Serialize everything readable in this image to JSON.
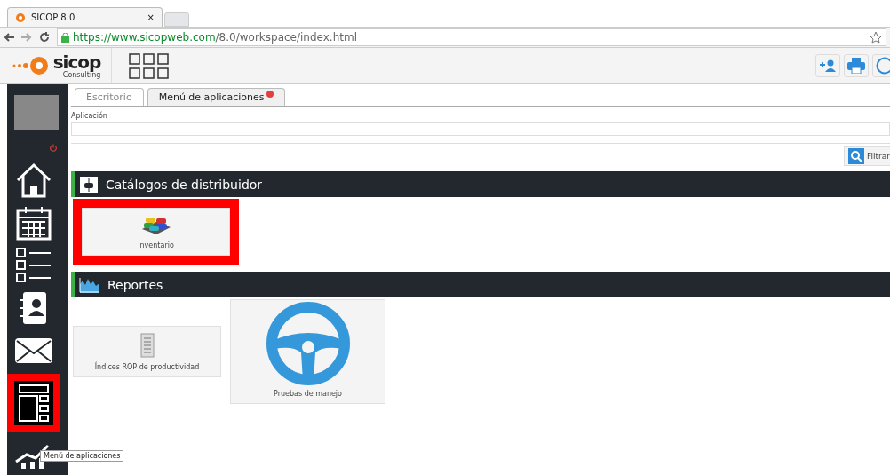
{
  "browser": {
    "tab_title": "SICOP 8.0",
    "tab_close": "×",
    "url_host": "https://www.sicopweb.com",
    "url_path": "/8.0/workspace/index.html"
  },
  "app": {
    "logo_text": "sicop",
    "logo_sub": "Consulting"
  },
  "sidebar": {
    "items": [
      {
        "kind": "home",
        "selected": false,
        "highlighted": false
      },
      {
        "kind": "calendar",
        "selected": false,
        "highlighted": false
      },
      {
        "kind": "checklist",
        "selected": false,
        "highlighted": false
      },
      {
        "kind": "contacts",
        "selected": false,
        "highlighted": false
      },
      {
        "kind": "mail",
        "selected": false,
        "highlighted": false
      },
      {
        "kind": "apps",
        "selected": true,
        "highlighted": true
      },
      {
        "kind": "chart",
        "selected": false,
        "highlighted": false
      }
    ],
    "tooltip": "Menú de aplicaciones"
  },
  "tabs": [
    {
      "label": "Escritorio",
      "selected": false,
      "closable": false
    },
    {
      "label": "Menú de aplicaciones",
      "selected": true,
      "closable": true
    }
  ],
  "filter": {
    "label": "Aplicación",
    "button": "Filtrar"
  },
  "sections": [
    {
      "title": "Catálogos de distribuidor",
      "kind": "catalog",
      "tiles": [
        {
          "label": "Inventario",
          "kind": "cars",
          "highlighted": true
        }
      ]
    },
    {
      "title": "Reportes",
      "kind": "reports",
      "tiles": [
        {
          "label": "Índices ROP de productividad",
          "kind": "document",
          "highlighted": false
        },
        {
          "label": "Pruebas de manejo",
          "kind": "wheel",
          "highlighted": false
        }
      ]
    }
  ]
}
